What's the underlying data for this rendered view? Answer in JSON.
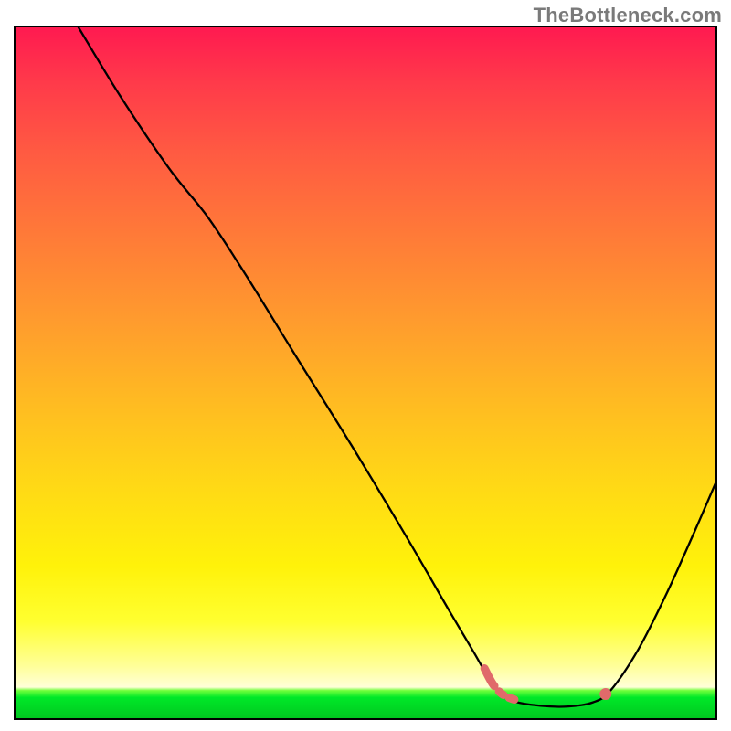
{
  "watermark": "TheBottleneck.com",
  "chart_data": {
    "type": "line",
    "title": "",
    "xlabel": "",
    "ylabel": "",
    "xlim": [
      0,
      100
    ],
    "ylim": [
      0,
      100
    ],
    "grid": false,
    "curve": [
      {
        "x": 9.0,
        "y": 100.0
      },
      {
        "x": 15.0,
        "y": 90.0
      },
      {
        "x": 22.0,
        "y": 79.5
      },
      {
        "x": 27.5,
        "y": 72.5
      },
      {
        "x": 33.0,
        "y": 64.0
      },
      {
        "x": 40.0,
        "y": 52.5
      },
      {
        "x": 48.0,
        "y": 39.5
      },
      {
        "x": 56.0,
        "y": 26.0
      },
      {
        "x": 62.0,
        "y": 15.5
      },
      {
        "x": 65.5,
        "y": 9.5
      },
      {
        "x": 67.5,
        "y": 6.0
      },
      {
        "x": 69.0,
        "y": 4.0
      },
      {
        "x": 71.0,
        "y": 2.5
      },
      {
        "x": 75.0,
        "y": 1.8
      },
      {
        "x": 79.0,
        "y": 1.7
      },
      {
        "x": 82.5,
        "y": 2.3
      },
      {
        "x": 85.0,
        "y": 4.0
      },
      {
        "x": 89.0,
        "y": 10.0
      },
      {
        "x": 93.0,
        "y": 18.0
      },
      {
        "x": 97.0,
        "y": 27.0
      },
      {
        "x": 100.0,
        "y": 34.0
      }
    ],
    "dashed_segment": {
      "description": "Short salmon dashed overlay near trough region",
      "points": [
        {
          "x": 67.0,
          "y": 7.2
        },
        {
          "x": 68.3,
          "y": 4.8
        },
        {
          "x": 70.0,
          "y": 3.2
        },
        {
          "x": 73.0,
          "y": 2.3
        },
        {
          "x": 77.0,
          "y": 1.9
        },
        {
          "x": 80.5,
          "y": 2.0
        },
        {
          "x": 83.5,
          "y": 3.0
        }
      ],
      "color": "#e06a6a"
    },
    "marker": {
      "x": 84.3,
      "y": 3.5,
      "color": "#e06a6a"
    }
  },
  "colors": {
    "curve_stroke": "#000000",
    "dashed_stroke": "#e06a6a",
    "marker_fill": "#e06a6a"
  }
}
